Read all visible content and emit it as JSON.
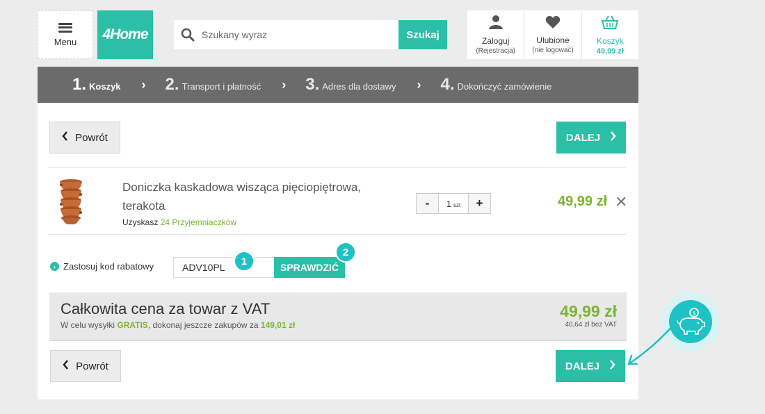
{
  "header": {
    "menu_label": "Menu",
    "logo_text": "4Home",
    "search_placeholder": "Szukany wyraz",
    "search_button": "Szukaj",
    "account": {
      "label": "Zaloguj",
      "sub": "(Rejestracja)"
    },
    "favorites": {
      "label": "Ulubione",
      "sub": "(nie logować)"
    },
    "cart": {
      "label": "Koszyk",
      "sub": "49,99 zł"
    }
  },
  "steps": [
    {
      "num": "1.",
      "label": "Koszyk"
    },
    {
      "num": "2.",
      "label": "Transport i płatność"
    },
    {
      "num": "3.",
      "label": "Adres dla dostawy"
    },
    {
      "num": "4.",
      "label": "Dokończyć zamówienie"
    }
  ],
  "nav": {
    "back_label": "Powrót",
    "next_label": "DALEJ"
  },
  "product": {
    "name_line1": "Doniczka kaskadowa wisząca pięciopiętrowa,",
    "name_line2": "terakota",
    "gain_prefix": "Uzyskasz",
    "gain_value": "24 Przyjemniaczków",
    "quantity": "1",
    "unit": "szt",
    "minus": "-",
    "plus": "+",
    "price": "49,99 zł",
    "remove": "✕"
  },
  "coupon": {
    "label": "Zastosuj kod rabatowy",
    "value": "ADV10PL",
    "button": "SPRAWDZIĆ",
    "badge1": "1",
    "badge2": "2"
  },
  "total": {
    "title": "Całkowita cena za towar z VAT",
    "sub_prefix": "W celu wysyłki",
    "sub_free": "GRATIS",
    "sub_mid": ", dokonaj jeszcze zakupów za",
    "sub_amount": "149,01 zł",
    "price": "49,99 zł",
    "net": "40,64 zł bez VAT"
  },
  "colors": {
    "accent": "#2bbfa8",
    "price_green": "#7ab52f",
    "steps_bg": "#6b6b6b",
    "badge": "#1ec1c4"
  }
}
